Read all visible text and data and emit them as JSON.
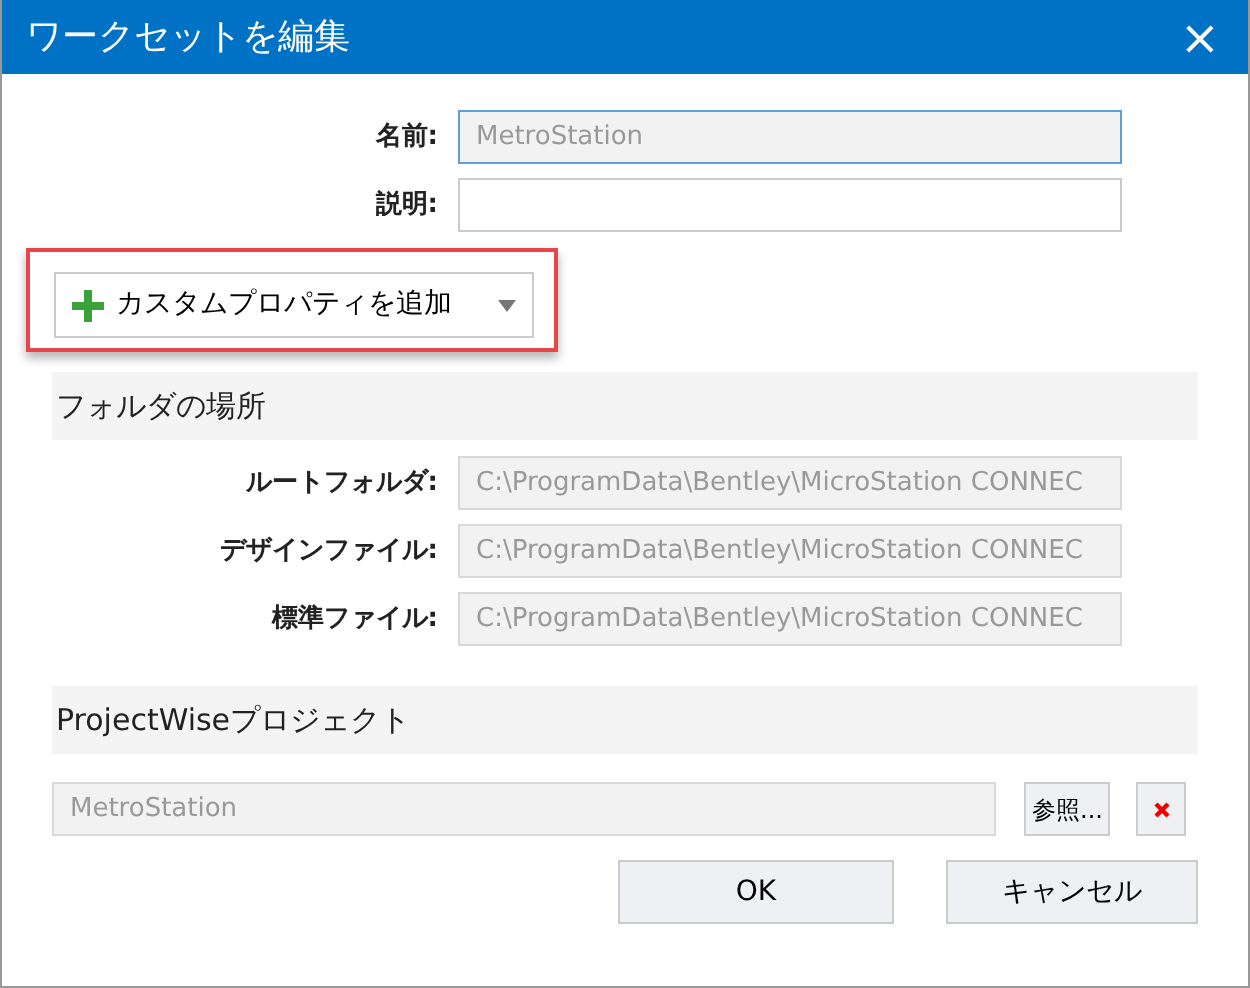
{
  "window": {
    "title": "ワークセットを編集",
    "close": "×"
  },
  "fields": [
    {
      "label": "名前:",
      "value": "MetroStation",
      "disabled": true,
      "focused": true
    },
    {
      "label": "説明:",
      "disabled": false,
      "focused": false
    }
  ],
  "add_property_button": {
    "label": "カスタムプロパティを追加",
    "highlighted": true
  },
  "folder_section": {
    "title": "フォルダの場所",
    "fields": [
      {
        "label": "ルートフォルダ:",
        "value": "C:\\ProgramData\\Bentley\\MicroStation CONNEC",
        "disabled": true
      },
      {
        "label": "デザインファイル:",
        "value": "C:\\ProgramData\\Bentley\\MicroStation CONNEC",
        "disabled": true
      },
      {
        "label": "標準ファイル:",
        "value": "C:\\ProgramData\\Bentley\\MicroStation CONNEC",
        "disabled": true
      }
    ]
  },
  "projectwise_section": {
    "title": "ProjectWiseプロジェクト",
    "value": "MetroStation",
    "disabled": true,
    "browse_button": "参照..."
  },
  "buttons": [
    "OK",
    "キャンセル"
  ]
}
